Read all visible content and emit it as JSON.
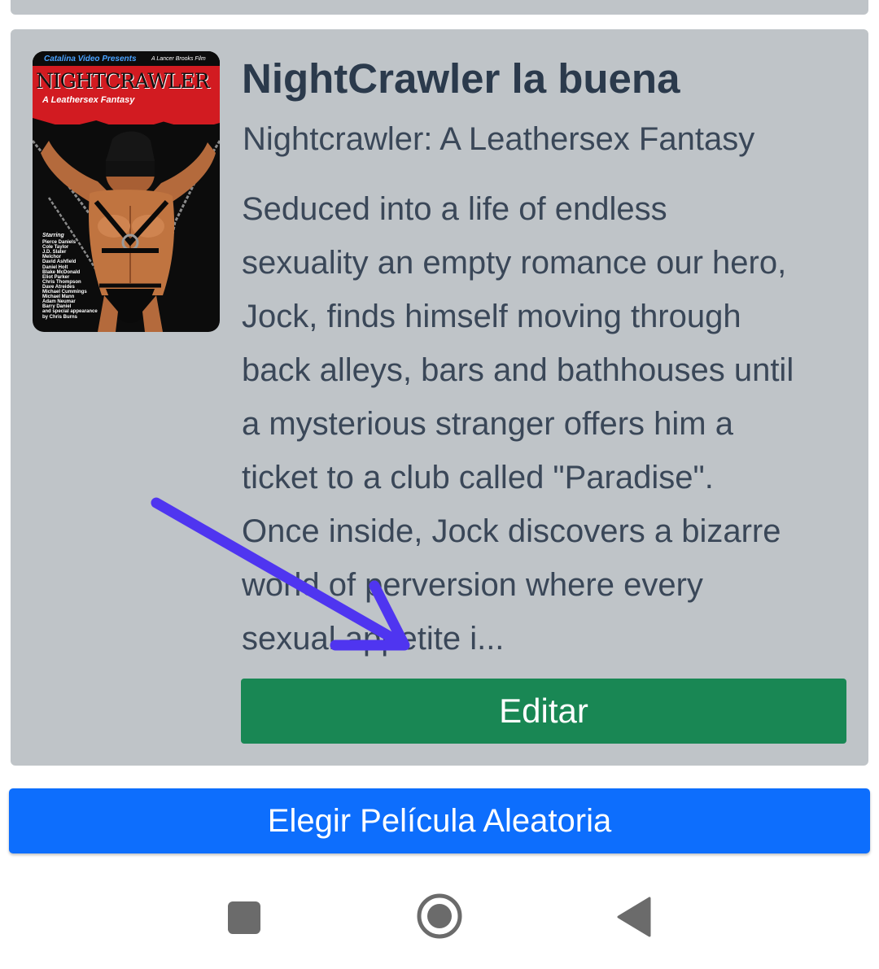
{
  "movie": {
    "title": "NightCrawler la buena",
    "original_title": "Nightcrawler: A Leathersex Fantasy",
    "synopsis_lines": [
      "Seduced into a life of endless",
      "sexuality an empty romance our hero,",
      "Jock, finds himself moving through",
      "back alleys, bars and bathhouses until",
      "a mysterious stranger offers him a",
      "ticket to a club called \"Paradise\".",
      "Once inside, Jock discovers a bizarre",
      "world of perversion where every",
      "sexual appetite i..."
    ],
    "poster": {
      "studio": "Catalina Video Presents",
      "presents": "A Lancer Brooks Film",
      "title": "NIGHTCRAWLER",
      "subtitle": "A Leathersex Fantasy",
      "starring_heading": "Starring",
      "cast": [
        "Pierce Daniels",
        "Cole Taylor",
        "J.D. Slater",
        "Melchor",
        "David Ashfield",
        "Daniel Holt",
        "Blake McDonald",
        "Eliot Parker",
        "Chris Thompson",
        "Dave Atreides",
        "Michael Cummings",
        "Michael Mann",
        "Adam Neumar",
        "Barry Daniel",
        "and special appearance",
        "by Chris Burns"
      ]
    },
    "edit_label": "Editar"
  },
  "random_button_label": "Elegir Película Aleatoria",
  "colors": {
    "card_bg": "#bfc4c8",
    "edit_button": "#198754",
    "random_button": "#0d6efd",
    "annotation_arrow": "#4f35f0",
    "title_text": "#2b3a4c"
  },
  "icons": {
    "annotation": "arrow-annotation-icon",
    "nav_recents": "square-recents-icon",
    "nav_home": "circle-home-icon",
    "nav_back": "triangle-back-icon"
  }
}
